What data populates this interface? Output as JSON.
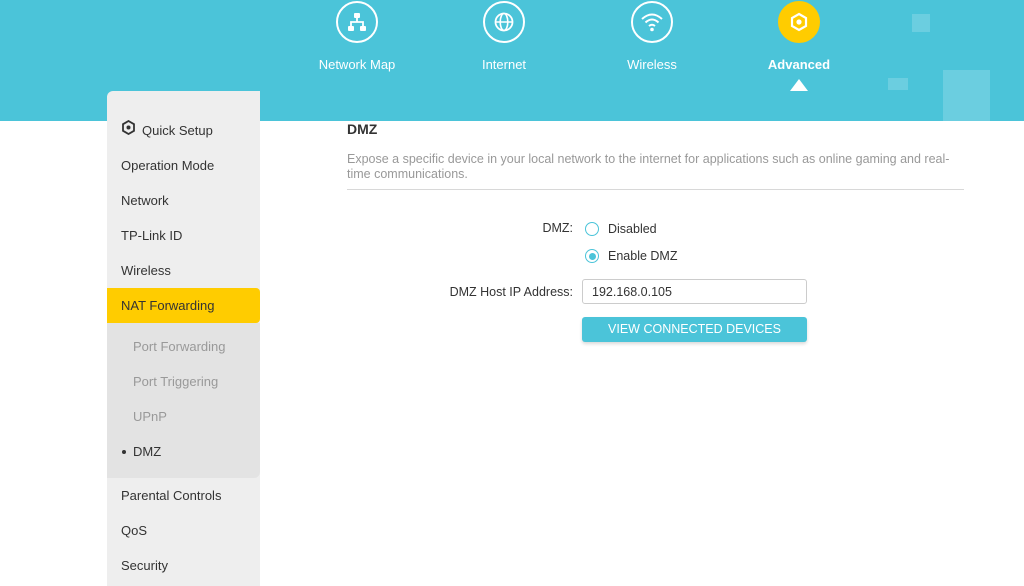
{
  "colors": {
    "accent": "#4bc4d9",
    "active": "#ffcc00",
    "sidebar_bg": "#eeeeee"
  },
  "topnav": {
    "items": [
      {
        "label": "Network Map",
        "icon": "network-map-icon"
      },
      {
        "label": "Internet",
        "icon": "globe-icon"
      },
      {
        "label": "Wireless",
        "icon": "wifi-icon"
      },
      {
        "label": "Advanced",
        "icon": "gear-icon",
        "active": true
      }
    ]
  },
  "sidebar": {
    "items": [
      {
        "label": "Quick Setup",
        "icon": "quick-setup-icon"
      },
      {
        "label": "Operation Mode"
      },
      {
        "label": "Network"
      },
      {
        "label": "TP-Link ID"
      },
      {
        "label": "Wireless"
      },
      {
        "label": "NAT Forwarding",
        "active": true
      },
      {
        "label": "Parental Controls"
      },
      {
        "label": "QoS"
      },
      {
        "label": "Security"
      }
    ],
    "submenu": [
      {
        "label": "Port Forwarding"
      },
      {
        "label": "Port Triggering"
      },
      {
        "label": "UPnP"
      },
      {
        "label": "DMZ",
        "active": true
      }
    ]
  },
  "main": {
    "title": "DMZ",
    "description": "Expose a specific device in your local network to the internet for applications such as online gaming and real-time communications.",
    "dmz_label": "DMZ:",
    "options": [
      {
        "label": "Disabled",
        "checked": false
      },
      {
        "label": "Enable DMZ",
        "checked": true
      }
    ],
    "host_ip_label": "DMZ Host IP Address:",
    "host_ip_value": "192.168.0.105",
    "view_devices_button": "VIEW CONNECTED DEVICES"
  }
}
